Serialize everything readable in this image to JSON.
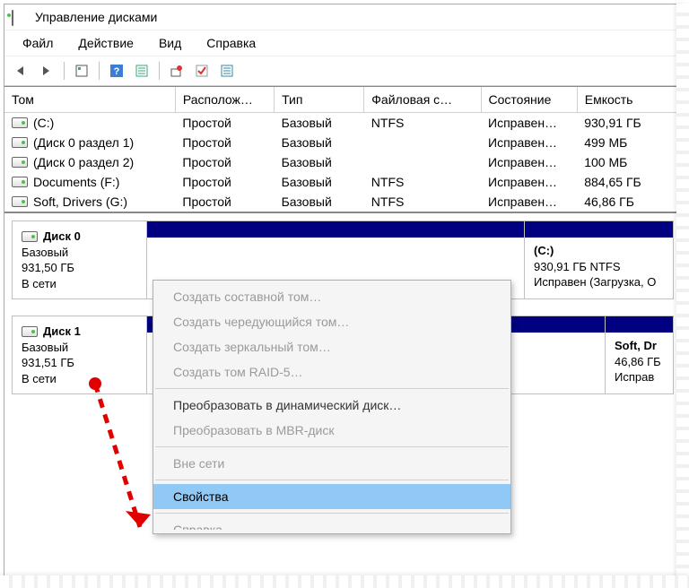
{
  "window": {
    "title": "Управление дисками"
  },
  "menu": {
    "file": "Файл",
    "action": "Действие",
    "view": "Вид",
    "help": "Справка"
  },
  "columns": {
    "volume": "Том",
    "layout": "Располож…",
    "type": "Тип",
    "fs": "Файловая с…",
    "status": "Состояние",
    "capacity": "Емкость"
  },
  "volumes": [
    {
      "name": "(C:)",
      "layout": "Простой",
      "type": "Базовый",
      "fs": "NTFS",
      "status": "Исправен…",
      "capacity": "930,91 ГБ"
    },
    {
      "name": "(Диск 0 раздел 1)",
      "layout": "Простой",
      "type": "Базовый",
      "fs": "",
      "status": "Исправен…",
      "capacity": "499 МБ"
    },
    {
      "name": "(Диск 0 раздел 2)",
      "layout": "Простой",
      "type": "Базовый",
      "fs": "",
      "status": "Исправен…",
      "capacity": "100 МБ"
    },
    {
      "name": "Documents (F:)",
      "layout": "Простой",
      "type": "Базовый",
      "fs": "NTFS",
      "status": "Исправен…",
      "capacity": "884,65 ГБ"
    },
    {
      "name": "Soft, Drivers (G:)",
      "layout": "Простой",
      "type": "Базовый",
      "fs": "NTFS",
      "status": "Исправен…",
      "capacity": "46,86 ГБ"
    }
  ],
  "disks": [
    {
      "label": "Диск 0",
      "type": "Базовый",
      "size": "931,50 ГБ",
      "status": "В сети",
      "partitions": [
        {
          "name": "(C:)",
          "line2": "930,91 ГБ NTFS",
          "line3": "Исправен (Загрузка, О",
          "width": 180
        }
      ],
      "lead_width": 420
    },
    {
      "label": "Диск 1",
      "type": "Базовый",
      "size": "931,51 ГБ",
      "status": "В сети",
      "partitions": [
        {
          "name": "Soft, Dr",
          "line2": "46,86 ГБ",
          "line3": "Исправ",
          "width": 90
        }
      ],
      "lead_width": 510
    }
  ],
  "context_menu": {
    "items": [
      {
        "label": "Создать составной том…",
        "disabled": true
      },
      {
        "label": "Создать чередующийся том…",
        "disabled": true
      },
      {
        "label": "Создать зеркальный том…",
        "disabled": true
      },
      {
        "label": "Создать том RAID-5…",
        "disabled": true
      },
      {
        "sep": true
      },
      {
        "label": "Преобразовать в динамический диск…",
        "disabled": false
      },
      {
        "label": "Преобразовать в MBR-диск",
        "disabled": true
      },
      {
        "sep": true
      },
      {
        "label": "Вне сети",
        "disabled": true
      },
      {
        "sep": true
      },
      {
        "label": "Свойства",
        "disabled": false,
        "hover": true
      },
      {
        "sep": true
      },
      {
        "label": "Справка",
        "disabled": false,
        "cut": true
      }
    ]
  }
}
